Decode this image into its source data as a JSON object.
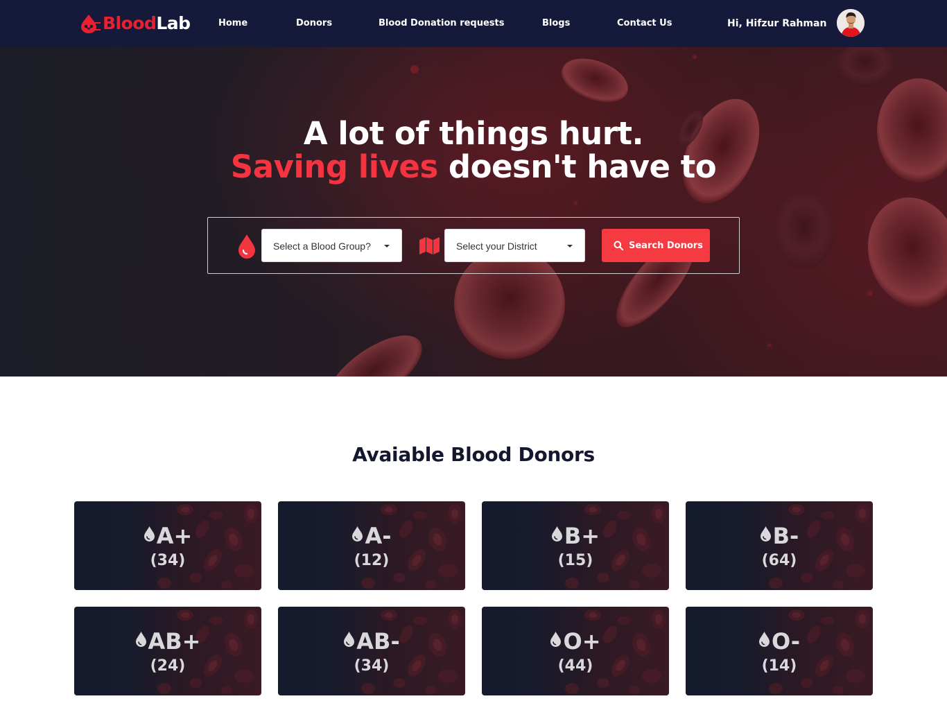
{
  "brand": {
    "name_part1": "Blood",
    "name_part2": "Lab",
    "accent_color": "#e8202f"
  },
  "nav": {
    "links": [
      {
        "label": "Home"
      },
      {
        "label": "Donors"
      },
      {
        "label": "Blood Donation requests"
      },
      {
        "label": "Blogs"
      },
      {
        "label": "Contact Us"
      }
    ],
    "greeting": "Hi, Hifzur Rahman"
  },
  "hero": {
    "line1": "A lot of things hurt.",
    "line2_highlight": "Saving lives",
    "line2_rest": " doesn't have to",
    "blood_group_select": {
      "value": "Select a Blood Group?",
      "icon": "blood-drop-icon"
    },
    "district_select": {
      "value": "Select your District",
      "icon": "map-icon"
    },
    "search_button": {
      "label": "Search Donors",
      "icon": "search-icon"
    }
  },
  "donors": {
    "title": "Avaiable Blood Donors",
    "groups": [
      {
        "group": "A+",
        "count": "(34)"
      },
      {
        "group": "A-",
        "count": "(12)"
      },
      {
        "group": "B+",
        "count": "(15)"
      },
      {
        "group": "B-",
        "count": "(64)"
      },
      {
        "group": "AB+",
        "count": "(24)"
      },
      {
        "group": "AB-",
        "count": "(34)"
      },
      {
        "group": "O+",
        "count": "(44)"
      },
      {
        "group": "O-",
        "count": "(14)"
      }
    ]
  }
}
